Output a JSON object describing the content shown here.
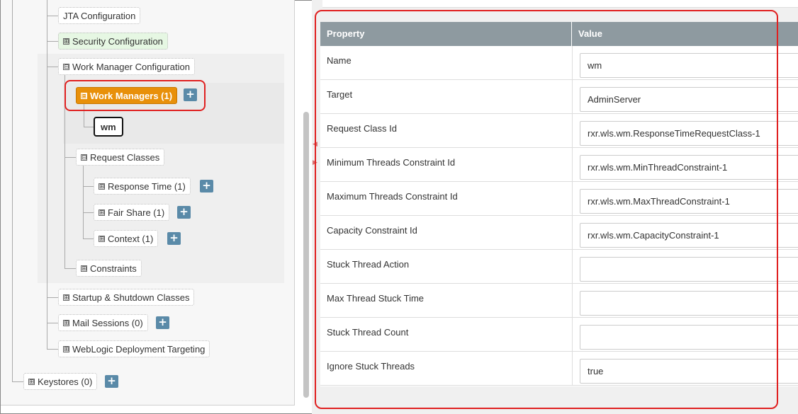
{
  "tree": {
    "jta": "JTA Configuration",
    "security": "Security Configuration",
    "work_manager_config": "Work Manager Configuration",
    "work_managers": "Work Managers (1)",
    "wm_node": "wm",
    "request_classes": "Request Classes",
    "response_time": "Response Time (1)",
    "fair_share": "Fair Share (1)",
    "context": "Context (1)",
    "constraints": "Constraints",
    "startup_shutdown": "Startup & Shutdown Classes",
    "mail_sessions": "Mail Sessions (0)",
    "deployment_targeting": "WebLogic Deployment Targeting",
    "keystores": "Keystores (0)",
    "expand_symbol": "⊞",
    "collapse_symbol": "⊟",
    "add_symbol": "+"
  },
  "table": {
    "header_property": "Property",
    "header_value": "Value",
    "rows": [
      {
        "property": "Name",
        "value": "wm"
      },
      {
        "property": "Target",
        "value": "AdminServer"
      },
      {
        "property": "Request Class Id",
        "value": "rxr.wls.wm.ResponseTimeRequestClass-1"
      },
      {
        "property": "Minimum Threads Constraint Id",
        "value": "rxr.wls.wm.MinThreadConstraint-1"
      },
      {
        "property": "Maximum Threads Constraint Id",
        "value": "rxr.wls.wm.MaxThreadConstraint-1"
      },
      {
        "property": "Capacity Constraint Id",
        "value": "rxr.wls.wm.CapacityConstraint-1"
      },
      {
        "property": "Stuck Thread Action",
        "value": ""
      },
      {
        "property": "Max Thread Stuck Time",
        "value": ""
      },
      {
        "property": "Stuck Thread Count",
        "value": ""
      },
      {
        "property": "Ignore Stuck Threads",
        "value": "true"
      }
    ]
  },
  "colors": {
    "highlight": "#e02020",
    "active_node": "#e8900a",
    "add_button": "#5a8aa8",
    "table_header": "#8e9aa0"
  }
}
